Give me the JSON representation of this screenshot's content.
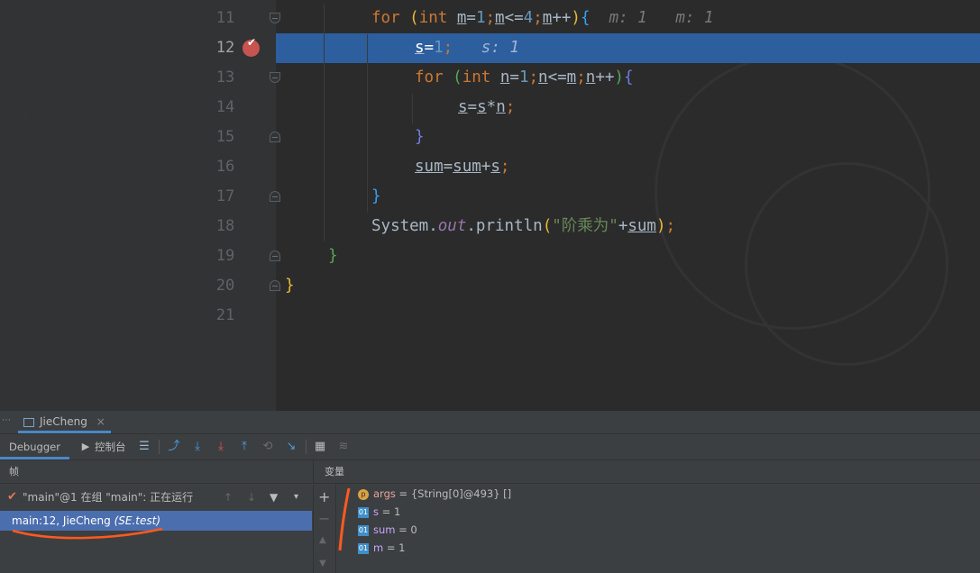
{
  "editor": {
    "line_numbers": [
      "11",
      "12",
      "13",
      "14",
      "15",
      "16",
      "17",
      "18",
      "19",
      "20",
      "21"
    ],
    "current_line": "12",
    "lines": {
      "l11": {
        "kw_for": "for",
        "p_open": "(",
        "kw_int": "int",
        "v1": "m",
        "t1": "=",
        "n1": "1",
        "t2": ";",
        "v2": "m",
        "t3": "<=",
        "n2": "4",
        "t4": ";",
        "v3": "m",
        "t5": "++",
        "p_close": ")",
        "brace": "{",
        "hint1": "m: 1",
        "hint2": "m: 1"
      },
      "l12": {
        "v": "s",
        "t1": "=",
        "n1": "1",
        "t2": ";",
        "hint": "s: 1"
      },
      "l13": {
        "kw_for": "for",
        "p_open": "(",
        "kw_int": "int",
        "v1": "n",
        "t1": "=",
        "n1": "1",
        "t2": ";",
        "v2": "n",
        "t3": "<=",
        "v3": "m",
        "t4": ";",
        "v4": "n",
        "t5": "++",
        "p_close": ")",
        "brace": "{"
      },
      "l14": {
        "v1": "s",
        "t1": "=",
        "v2": "s",
        "t2": "*",
        "v3": "n",
        "t3": ";"
      },
      "l15": {
        "brace": "}"
      },
      "l16": {
        "v1": "sum",
        "t1": "=",
        "v2": "sum",
        "t2": "+",
        "v3": "s",
        "t3": ";"
      },
      "l17": {
        "brace": "}"
      },
      "l18": {
        "cls": "System",
        "dot1": ".",
        "fld": "out",
        "dot2": ".",
        "mth": "println",
        "p_open": "(",
        "str": "\"阶乘为\"",
        "plus": "+",
        "v": "sum",
        "p_close": ")",
        "semi": ";"
      },
      "l19": {
        "brace": "}"
      },
      "l20": {
        "brace": "}"
      }
    }
  },
  "debug_panel": {
    "run_tab": "JieCheng",
    "run_tab_close": "×",
    "debugger_tab": "Debugger",
    "console_tab": "控制台",
    "frames_header": "帧",
    "variables_header": "变量",
    "thread": "\"main\"@1 在组 \"main\": 正在运行",
    "frame": {
      "location": "main:12, JieCheng",
      "package": "(SE.test)"
    },
    "variables": [
      {
        "icon": "p",
        "name": "args",
        "value": " = {String[0]@493} []"
      },
      {
        "icon": "01",
        "name": "s",
        "value": " = 1"
      },
      {
        "icon": "01",
        "name": "sum",
        "value": " = 0"
      },
      {
        "icon": "01",
        "name": "m",
        "value": " = 1"
      }
    ]
  },
  "colors": {
    "execution_line": "#2d5e9e",
    "breakpoint": "#c75450",
    "annotation": "#ff5a1f"
  }
}
